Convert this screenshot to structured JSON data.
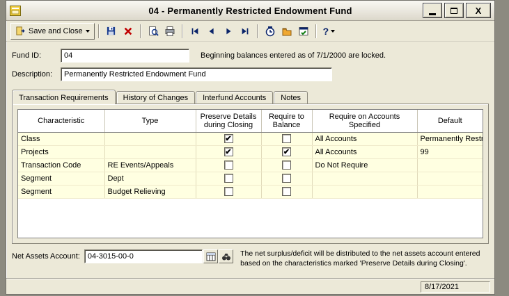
{
  "window": {
    "title": "04 - Permanently Restricted Endowment Fund",
    "close_label": "X"
  },
  "toolbar": {
    "save_and_close_label": "Save and Close",
    "help_label": "?"
  },
  "icons": {
    "check": "✔",
    "prev": "◀",
    "next": "▶"
  },
  "fields": {
    "fund_id": {
      "label": "Fund ID:",
      "value": "04"
    },
    "locked_note": "Beginning balances entered as of 7/1/2000 are locked.",
    "description": {
      "label": "Description:",
      "value": "Permanently Restricted Endowment Fund"
    }
  },
  "tabs": [
    {
      "label": "Transaction Requirements",
      "active": true
    },
    {
      "label": "History of Changes",
      "active": false
    },
    {
      "label": "Interfund Accounts",
      "active": false
    },
    {
      "label": "Notes",
      "active": false
    }
  ],
  "table": {
    "headers": [
      "Characteristic",
      "Type",
      "Preserve Details during Closing",
      "Require to Balance",
      "Require on Accounts Specified",
      "Default"
    ],
    "rows": [
      {
        "characteristic": "Class",
        "type": "",
        "preserve_details": true,
        "require_to_balance": false,
        "require_on_accounts": "All Accounts",
        "default": "Permanently Restri..."
      },
      {
        "characteristic": "Projects",
        "type": "",
        "preserve_details": true,
        "require_to_balance": true,
        "require_on_accounts": "All Accounts",
        "default": "99"
      },
      {
        "characteristic": "Transaction Code",
        "type": "RE Events/Appeals",
        "preserve_details": false,
        "require_to_balance": false,
        "require_on_accounts": "Do Not Require",
        "default": ""
      },
      {
        "characteristic": "Segment",
        "type": "Dept",
        "preserve_details": false,
        "require_to_balance": false,
        "require_on_accounts": "",
        "default": ""
      },
      {
        "characteristic": "Segment",
        "type": "Budget Relieving",
        "preserve_details": false,
        "require_to_balance": false,
        "require_on_accounts": "",
        "default": ""
      }
    ]
  },
  "footer": {
    "net_assets_label": "Net Assets Account:",
    "net_assets_value": "04-3015-00-0",
    "note": "The net surplus/deficit will be distributed to the net assets account entered based on the characteristics marked 'Preserve Details during Closing'."
  },
  "statusbar": {
    "date": "8/17/2021"
  }
}
